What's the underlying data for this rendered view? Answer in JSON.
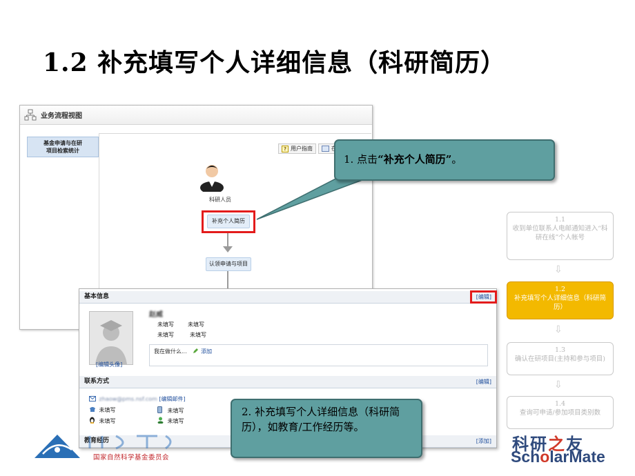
{
  "slide": {
    "title": "1.2 补充填写个人详细信息（科研简历）"
  },
  "workflow": {
    "window_title": "业务流程视图",
    "side_tab": "基金申请与在研\n项目检索统计",
    "help_button": "用户指南",
    "second_button": "在",
    "person_label": "科研人员",
    "node_supplement": "补充个人简历",
    "node_confirm": "认领申请与项目"
  },
  "profile": {
    "basic_title": "基本信息",
    "edit_label": "[编辑]",
    "edit_avatar": "[编辑头像]",
    "name": "赵威",
    "fields": [
      "未填写",
      "未填写",
      "未填写",
      "未填写"
    ],
    "status_placeholder": "我在做什么...",
    "status_add": "添加",
    "contact_title": "联系方式",
    "contact_edit": "[编辑]",
    "email_blurred": "zhaow@pms.nsf.com",
    "edit_mail": "[编辑邮件]",
    "contact_values": [
      "未填写",
      "未填写",
      "未填写",
      "未填写"
    ],
    "edu_title": "教育经历",
    "edu_add": "[添加]"
  },
  "callouts": {
    "c1_prefix": "1.  点击",
    "c1_bold": "“补充个人简历”",
    "c1_suffix": "。",
    "c2": "2.  补充填写个人详细信息（科研简历），如教育/工作经历等。"
  },
  "steps": [
    {
      "num": "1.1",
      "text": "收到单位联系人电邮通知进入“科研在线”个人帐号",
      "active": false
    },
    {
      "num": "1.2",
      "text": "补充填写个人详细信息（科研简历）",
      "active": true
    },
    {
      "num": "1.3",
      "text": "确认在研项目(主持和参与项目)",
      "active": false
    },
    {
      "num": "1.4",
      "text": "查询可申请/参加项目类别数",
      "active": false
    }
  ],
  "logos": {
    "nsfc_text": "国家自然科学基金委员会",
    "sm_cn_1": "科研",
    "sm_cn_2": "之",
    "sm_cn_3": "友",
    "sm_en_1": "Sch",
    "sm_en_2": "o",
    "sm_en_3": "larMate"
  },
  "colors": {
    "callout": "#5f9fa0",
    "step_active": "#f3b900",
    "highlight_red": "#e31b1b",
    "link": "#1f4e9c"
  }
}
